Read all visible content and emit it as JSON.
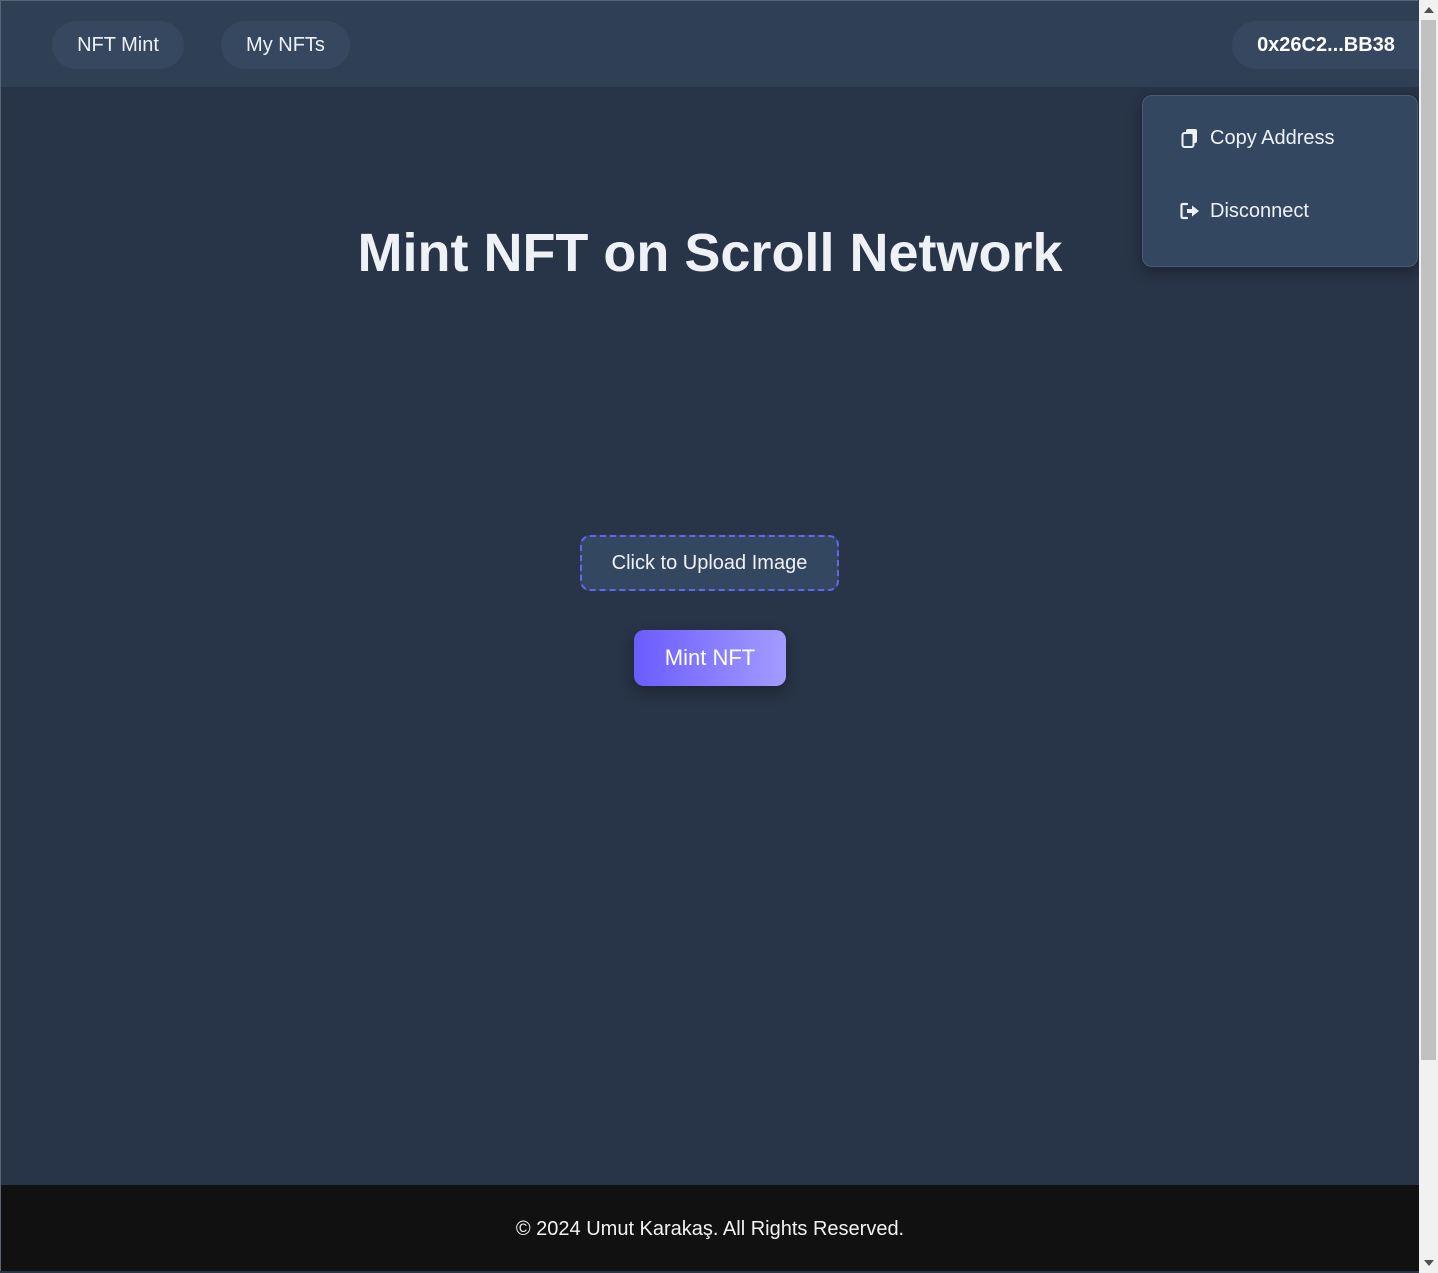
{
  "navbar": {
    "links": [
      {
        "label": "NFT Mint"
      },
      {
        "label": "My NFTs"
      }
    ],
    "wallet_address": "0x26C2...BB38"
  },
  "wallet_menu": {
    "copy_label": "Copy Address",
    "disconnect_label": "Disconnect",
    "copy_icon": "copy-icon",
    "disconnect_icon": "sign-out-icon"
  },
  "main": {
    "title": "Mint NFT on Scroll Network",
    "upload_label": "Click to Upload Image",
    "mint_label": "Mint NFT"
  },
  "footer": {
    "text": "© 2024 Umut Karakaş. All Rights Reserved."
  },
  "colors": {
    "background": "#283447",
    "navbar": "#2f3f54",
    "accent": "#6366f1",
    "footer": "#111111"
  }
}
